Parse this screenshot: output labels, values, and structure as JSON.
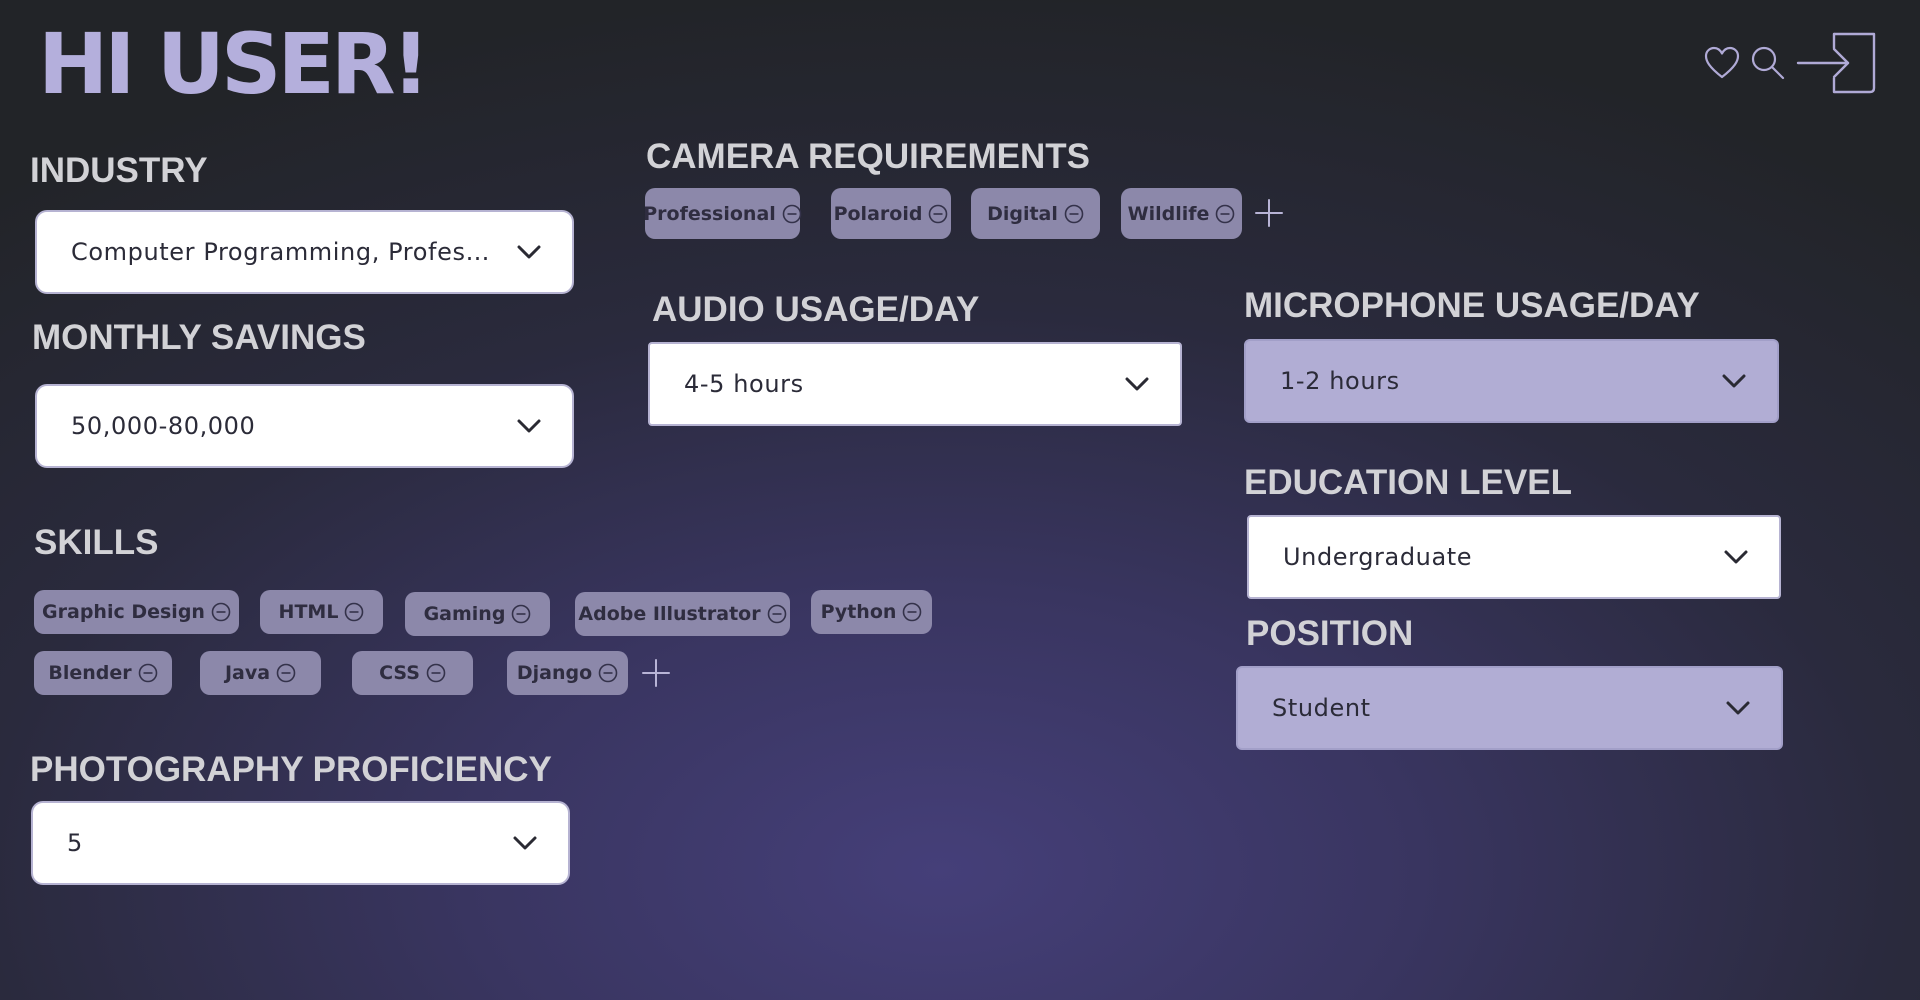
{
  "header": {
    "greeting": "HI USER!",
    "icons": [
      "heart-icon",
      "search-icon",
      "sign-in-icon"
    ]
  },
  "fields": {
    "industry": {
      "label": "INDUSTRY",
      "value": "Computer Programming, Professi..."
    },
    "monthly_savings": {
      "label": "MONTHLY SAVINGS",
      "value": "50,000-80,000"
    },
    "audio_usage": {
      "label": "AUDIO USAGE/DAY",
      "value": "4-5 hours"
    },
    "microphone_usage": {
      "label": "MICROPHONE USAGE/DAY",
      "value": "1-2 hours"
    },
    "education_level": {
      "label": "EDUCATION LEVEL",
      "value": "Undergraduate"
    },
    "position": {
      "label": "POSITION",
      "value": "Student"
    },
    "photography_proficiency": {
      "label": "PHOTOGRAPHY PROFICIENCY",
      "value": "5"
    }
  },
  "camera_requirements": {
    "label": "CAMERA REQUIREMENTS",
    "tags": [
      "Professional",
      "Polaroid",
      "Digital",
      "Wildlife"
    ]
  },
  "skills": {
    "label": "SKILLS",
    "tags": [
      "Graphic Design",
      "HTML",
      "Gaming",
      "Adobe Illustrator",
      "Python",
      "Blender",
      "Java",
      "CSS",
      "Django"
    ]
  },
  "colors": {
    "accent": "#b4afdc",
    "chip": "#8c88aa",
    "select_purple": "#b1add4",
    "background_center": "#453f79",
    "background_edge": "#222428"
  }
}
